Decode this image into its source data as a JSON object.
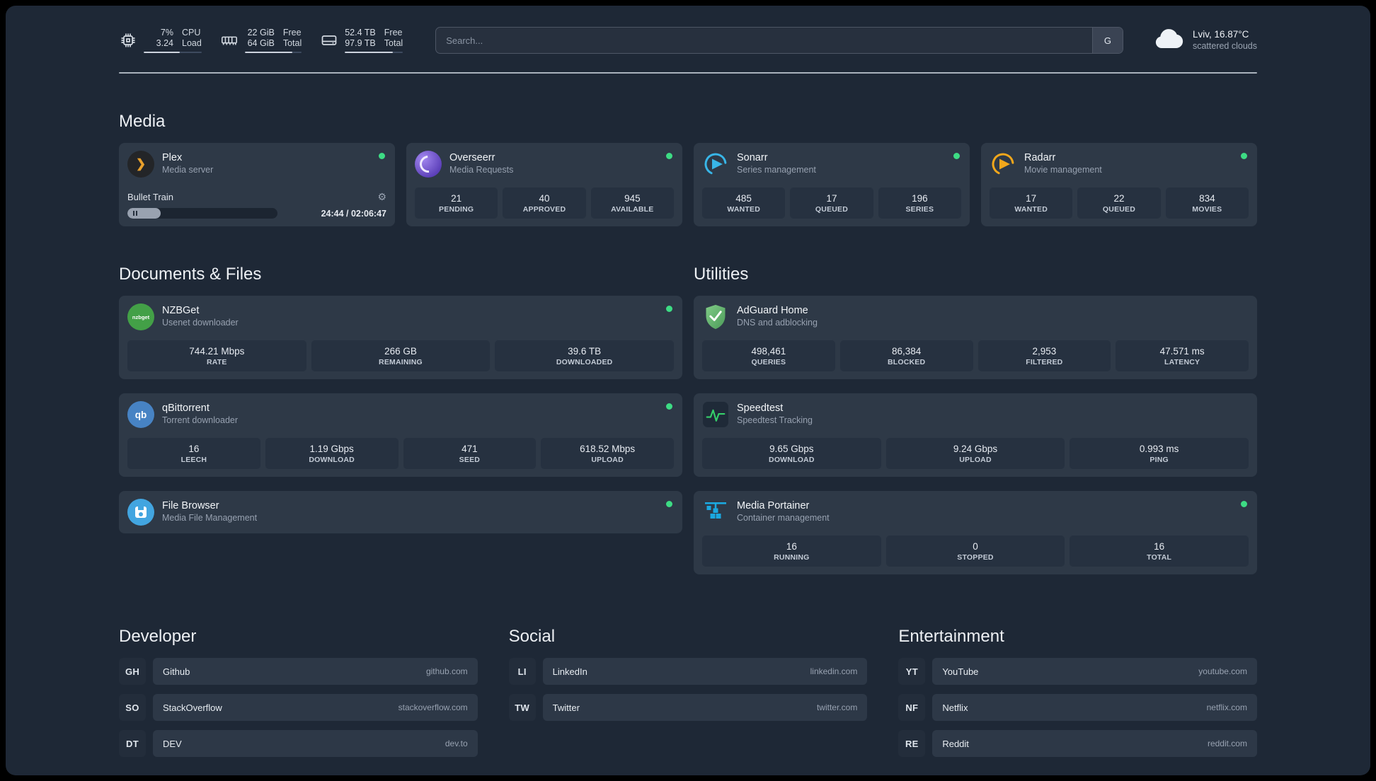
{
  "colors": {
    "background": "#1e2836",
    "card": "#2e3947",
    "stat_tile": "#263140",
    "status_online": "#3ddc84",
    "plex_accent": "#e8a02c",
    "overseerr_accent": "#7c5cdb",
    "sonarr_accent": "#38b6e8",
    "radarr_accent": "#f2a71b",
    "nzbget_accent": "#43a047",
    "qbittorrent_accent": "#4783c4",
    "adguard_accent": "#68b474",
    "speedtest_accent": "#35d06a",
    "filebrowser_accent": "#42a5e0",
    "portainer_accent": "#1ba8e0"
  },
  "glyphs": {
    "gear": "⚙",
    "plex_chevron": "❯"
  },
  "header": {
    "cpu": {
      "value_top": "7%",
      "value_bottom": "3.24",
      "label_top": "CPU",
      "label_bottom": "Load"
    },
    "memory": {
      "value_top": "22 GiB",
      "value_bottom": "64 GiB",
      "label_top": "Free",
      "label_bottom": "Total"
    },
    "disk": {
      "value_top": "52.4 TB",
      "value_bottom": "97.9 TB",
      "label_top": "Free",
      "label_bottom": "Total"
    },
    "search": {
      "placeholder": "Search...",
      "provider": "G"
    },
    "weather": {
      "location": "Lviv, 16.87°C",
      "condition": "scattered clouds"
    }
  },
  "sections": {
    "media": "Media",
    "documents": "Documents & Files",
    "utilities": "Utilities"
  },
  "media": {
    "plex": {
      "name": "Plex",
      "subtitle": "Media server",
      "now_playing": "Bullet Train",
      "time": "24:44 / 02:06:47"
    },
    "overseerr": {
      "name": "Overseerr",
      "subtitle": "Media Requests",
      "stats": [
        {
          "value": "21",
          "label": "PENDING"
        },
        {
          "value": "40",
          "label": "APPROVED"
        },
        {
          "value": "945",
          "label": "AVAILABLE"
        }
      ]
    },
    "sonarr": {
      "name": "Sonarr",
      "subtitle": "Series management",
      "stats": [
        {
          "value": "485",
          "label": "WANTED"
        },
        {
          "value": "17",
          "label": "QUEUED"
        },
        {
          "value": "196",
          "label": "SERIES"
        }
      ]
    },
    "radarr": {
      "name": "Radarr",
      "subtitle": "Movie management",
      "stats": [
        {
          "value": "17",
          "label": "WANTED"
        },
        {
          "value": "22",
          "label": "QUEUED"
        },
        {
          "value": "834",
          "label": "MOVIES"
        }
      ]
    }
  },
  "documents": {
    "nzbget": {
      "name": "NZBGet",
      "subtitle": "Usenet downloader",
      "icon_text": "nzbget",
      "stats": [
        {
          "value": "744.21 Mbps",
          "label": "RATE"
        },
        {
          "value": "266 GB",
          "label": "REMAINING"
        },
        {
          "value": "39.6 TB",
          "label": "DOWNLOADED"
        }
      ]
    },
    "qbittorrent": {
      "name": "qBittorrent",
      "subtitle": "Torrent downloader",
      "icon_text": "qb",
      "stats": [
        {
          "value": "16",
          "label": "LEECH"
        },
        {
          "value": "1.19 Gbps",
          "label": "DOWNLOAD"
        },
        {
          "value": "471",
          "label": "SEED"
        },
        {
          "value": "618.52 Mbps",
          "label": "UPLOAD"
        }
      ]
    },
    "filebrowser": {
      "name": "File Browser",
      "subtitle": "Media File Management"
    }
  },
  "utilities": {
    "adguard": {
      "name": "AdGuard Home",
      "subtitle": "DNS and adblocking",
      "stats": [
        {
          "value": "498,461",
          "label": "QUERIES"
        },
        {
          "value": "86,384",
          "label": "BLOCKED"
        },
        {
          "value": "2,953",
          "label": "FILTERED"
        },
        {
          "value": "47.571 ms",
          "label": "LATENCY"
        }
      ]
    },
    "speedtest": {
      "name": "Speedtest",
      "subtitle": "Speedtest Tracking",
      "stats": [
        {
          "value": "9.65 Gbps",
          "label": "DOWNLOAD"
        },
        {
          "value": "9.24 Gbps",
          "label": "UPLOAD"
        },
        {
          "value": "0.993 ms",
          "label": "PING"
        }
      ]
    },
    "portainer": {
      "name": "Media Portainer",
      "subtitle": "Container management",
      "stats": [
        {
          "value": "16",
          "label": "RUNNING"
        },
        {
          "value": "0",
          "label": "STOPPED"
        },
        {
          "value": "16",
          "label": "TOTAL"
        }
      ]
    }
  },
  "bookmarks": {
    "developer": {
      "title": "Developer",
      "items": [
        {
          "abbr": "GH",
          "name": "Github",
          "host": "github.com"
        },
        {
          "abbr": "SO",
          "name": "StackOverflow",
          "host": "stackoverflow.com"
        },
        {
          "abbr": "DT",
          "name": "DEV",
          "host": "dev.to"
        }
      ]
    },
    "social": {
      "title": "Social",
      "items": [
        {
          "abbr": "LI",
          "name": "LinkedIn",
          "host": "linkedin.com"
        },
        {
          "abbr": "TW",
          "name": "Twitter",
          "host": "twitter.com"
        }
      ]
    },
    "entertainment": {
      "title": "Entertainment",
      "items": [
        {
          "abbr": "YT",
          "name": "YouTube",
          "host": "youtube.com"
        },
        {
          "abbr": "NF",
          "name": "Netflix",
          "host": "netflix.com"
        },
        {
          "abbr": "RE",
          "name": "Reddit",
          "host": "reddit.com"
        }
      ]
    }
  }
}
